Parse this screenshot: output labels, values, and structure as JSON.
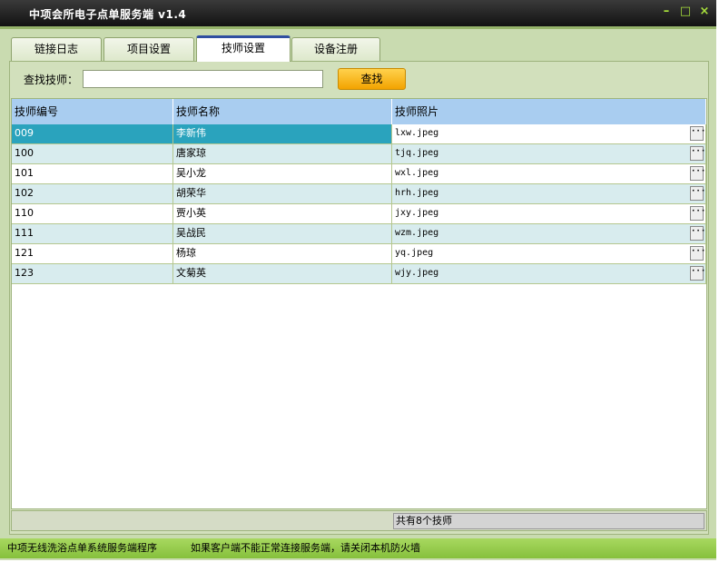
{
  "window": {
    "title": "中项会所电子点单服务端 v1.4",
    "controls": {
      "minimize": "–",
      "maximize": "□",
      "close": "×"
    }
  },
  "tabs": [
    {
      "label": "链接日志",
      "active": false
    },
    {
      "label": "项目设置",
      "active": false
    },
    {
      "label": "技师设置",
      "active": true
    },
    {
      "label": "设备注册",
      "active": false
    }
  ],
  "search": {
    "label": "查找技师：",
    "value": "",
    "button": "查找"
  },
  "table": {
    "columns": [
      "技师编号",
      "技师名称",
      "技师照片"
    ],
    "rows": [
      {
        "id": "009",
        "name": "李新伟",
        "photo": "lxw.jpeg",
        "selected": true
      },
      {
        "id": "100",
        "name": "唐家琼",
        "photo": "tjq.jpeg"
      },
      {
        "id": "101",
        "name": "吴小龙",
        "photo": "wxl.jpeg"
      },
      {
        "id": "102",
        "name": "胡荣华",
        "photo": "hrh.jpeg"
      },
      {
        "id": "110",
        "name": "贾小英",
        "photo": "jxy.jpeg"
      },
      {
        "id": "111",
        "name": "吴战民",
        "photo": "wzm.jpeg"
      },
      {
        "id": "121",
        "name": "杨琼",
        "photo": "yq.jpeg"
      },
      {
        "id": "123",
        "name": "文菊英",
        "photo": "wjy.jpeg"
      }
    ],
    "ellipsis": "···"
  },
  "footer": {
    "count_text": "共有8个技师"
  },
  "status": {
    "left": "中项无线洗浴点单系统服务端程序",
    "right": "如果客户端不能正常连接服务端，请关闭本机防火墙"
  },
  "colors": {
    "selected_row": "#2aa3bd",
    "alt_row": "#d8ecee",
    "header": "#a9cdf0",
    "accent_button": "#f3a300"
  }
}
